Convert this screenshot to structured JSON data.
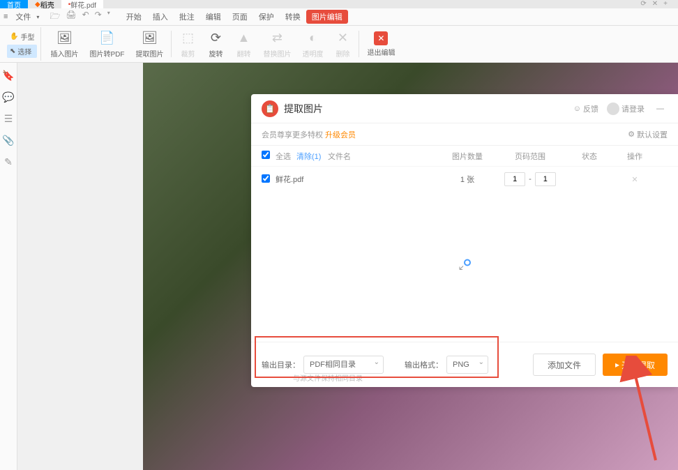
{
  "tabs": {
    "home": "首页",
    "tab2": "稻壳",
    "tab3": "鲜花.pdf"
  },
  "menubar": {
    "file": "文件",
    "items": [
      "开始",
      "插入",
      "批注",
      "编辑",
      "页面",
      "保护",
      "转换",
      "图片编辑"
    ]
  },
  "toolbar": {
    "hand": "手型",
    "select": "选择",
    "insert_image": "插入图片",
    "image_to_pdf": "图片转PDF",
    "extract_image": "提取图片",
    "crop": "裁剪",
    "rotate": "旋转",
    "flip": "翻转",
    "replace_image": "替换图片",
    "opacity": "透明度",
    "delete": "删除",
    "exit_edit": "退出编辑"
  },
  "dialog": {
    "title": "提取图片",
    "feedback": "反馈",
    "login": "请登录",
    "privilege_text": "会员尊享更多特权",
    "upgrade": "升级会员",
    "default_settings": "默认设置",
    "headers": {
      "select_all": "全选",
      "clear": "清除(1)",
      "filename": "文件名",
      "image_count": "图片数量",
      "page_range": "页码范围",
      "status": "状态",
      "operation": "操作"
    },
    "rows": [
      {
        "filename": "鲜花.pdf",
        "count": "1 张",
        "range_from": "1",
        "range_to": "1"
      }
    ],
    "output_dir_label": "输出目录：",
    "output_dir_value": "PDF相同目录",
    "output_format_label": "输出格式：",
    "output_format_value": "PNG",
    "hint": "与源文件保持相同目录",
    "add_file": "添加文件",
    "start_extract": "开始提取"
  }
}
